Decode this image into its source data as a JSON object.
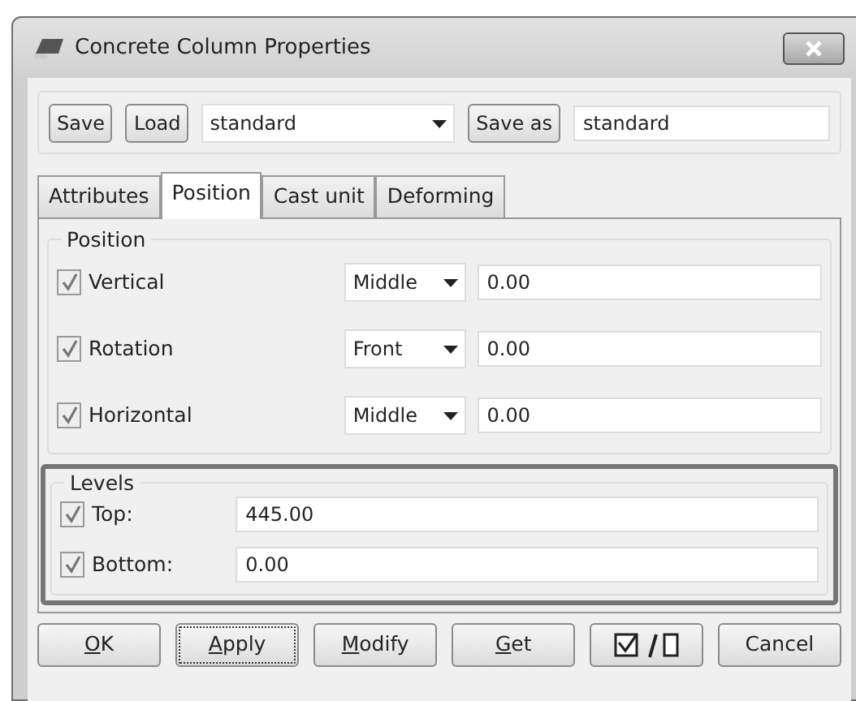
{
  "window": {
    "title": "Concrete Column Properties"
  },
  "toolbar": {
    "save_label": "Save",
    "load_label": "Load",
    "preset": "standard",
    "save_as_label": "Save as",
    "save_as_name": "standard"
  },
  "tabs": [
    {
      "label": "Attributes",
      "selected": false
    },
    {
      "label": "Position",
      "selected": true
    },
    {
      "label": "Cast unit",
      "selected": false
    },
    {
      "label": "Deforming",
      "selected": false
    }
  ],
  "position_group": {
    "title": "Position",
    "rows": [
      {
        "label": "Vertical",
        "checked": true,
        "option": "Middle",
        "value": "0.00"
      },
      {
        "label": "Rotation",
        "checked": true,
        "option": "Front",
        "value": "0.00"
      },
      {
        "label": "Horizontal",
        "checked": true,
        "option": "Middle",
        "value": "0.00"
      }
    ]
  },
  "levels_group": {
    "title": "Levels",
    "highlighted": true,
    "rows": [
      {
        "label": "Top:",
        "checked": true,
        "value": "445.00"
      },
      {
        "label": "Bottom:",
        "checked": true,
        "value": "0.00"
      }
    ]
  },
  "buttons": [
    {
      "kind": "text",
      "label": "OK",
      "mnemonic": true,
      "focused": false
    },
    {
      "kind": "text",
      "label": "Apply",
      "mnemonic": true,
      "focused": true
    },
    {
      "kind": "text",
      "label": "Modify",
      "mnemonic": true,
      "focused": false
    },
    {
      "kind": "text",
      "label": "Get",
      "mnemonic": true,
      "focused": false
    },
    {
      "kind": "toggle-all"
    },
    {
      "kind": "text",
      "label": "Cancel",
      "mnemonic": false,
      "focused": false
    }
  ]
}
